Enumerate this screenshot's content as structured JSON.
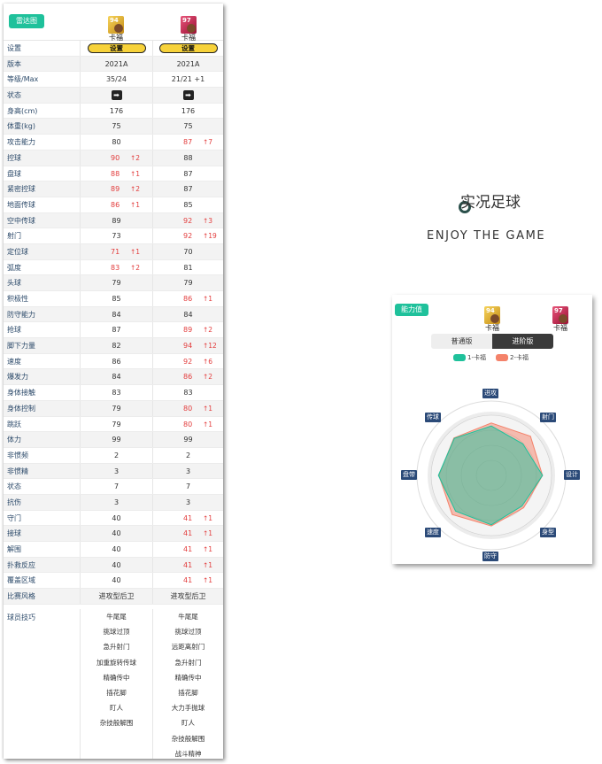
{
  "compare_panel": {
    "radar_button": "雷达图",
    "player1": {
      "rating": "94",
      "name": "卡福"
    },
    "player2": {
      "rating": "97",
      "name": "卡福"
    },
    "rows": [
      {
        "label": "设置",
        "type": "button",
        "v1": "设置",
        "v2": "设置"
      },
      {
        "label": "版本",
        "v1": "2021A",
        "v2": "2021A"
      },
      {
        "label": "等级/Max",
        "v1": "35/24",
        "v2": "21/21 +1"
      },
      {
        "label": "状态",
        "type": "arrow",
        "v1": "➡",
        "v2": "➡"
      },
      {
        "label": "身高(cm)",
        "v1": "176",
        "v2": "176"
      },
      {
        "label": "体重(kg)",
        "v1": "75",
        "v2": "75"
      },
      {
        "label": "攻击能力",
        "v1": "80",
        "v2": "87",
        "d2": "↑7"
      },
      {
        "label": "控球",
        "v1": "90",
        "d1": "↑2",
        "v2": "88"
      },
      {
        "label": "盘球",
        "v1": "88",
        "d1": "↑1",
        "v2": "87"
      },
      {
        "label": "紧密控球",
        "v1": "89",
        "d1": "↑2",
        "v2": "87"
      },
      {
        "label": "地面传球",
        "v1": "86",
        "d1": "↑1",
        "v2": "85"
      },
      {
        "label": "空中传球",
        "v1": "89",
        "v2": "92",
        "d2": "↑3"
      },
      {
        "label": "射门",
        "v1": "73",
        "v2": "92",
        "d2": "↑19"
      },
      {
        "label": "定位球",
        "v1": "71",
        "d1": "↑1",
        "v2": "70"
      },
      {
        "label": "弧度",
        "v1": "83",
        "d1": "↑2",
        "v2": "81"
      },
      {
        "label": "头球",
        "v1": "79",
        "v2": "79"
      },
      {
        "label": "积极性",
        "v1": "85",
        "v2": "86",
        "d2": "↑1"
      },
      {
        "label": "防守能力",
        "v1": "84",
        "v2": "84"
      },
      {
        "label": "抢球",
        "v1": "87",
        "v2": "89",
        "d2": "↑2"
      },
      {
        "label": "脚下力量",
        "v1": "82",
        "v2": "94",
        "d2": "↑12"
      },
      {
        "label": "速度",
        "v1": "86",
        "v2": "92",
        "d2": "↑6"
      },
      {
        "label": "爆发力",
        "v1": "84",
        "v2": "86",
        "d2": "↑2"
      },
      {
        "label": "身体接触",
        "v1": "83",
        "v2": "83"
      },
      {
        "label": "身体控制",
        "v1": "79",
        "v2": "80",
        "d2": "↑1"
      },
      {
        "label": "跳跃",
        "v1": "79",
        "v2": "80",
        "d2": "↑1"
      },
      {
        "label": "体力",
        "v1": "99",
        "v2": "99"
      },
      {
        "label": "非惯频",
        "v1": "2",
        "v2": "2"
      },
      {
        "label": "非惯精",
        "v1": "3",
        "v2": "3"
      },
      {
        "label": "状态",
        "v1": "7",
        "v2": "7"
      },
      {
        "label": "抗伤",
        "v1": "3",
        "v2": "3"
      },
      {
        "label": "守门",
        "v1": "40",
        "v2": "41",
        "d2": "↑1"
      },
      {
        "label": "接球",
        "v1": "40",
        "v2": "41",
        "d2": "↑1"
      },
      {
        "label": "解围",
        "v1": "40",
        "v2": "41",
        "d2": "↑1"
      },
      {
        "label": "扑救反应",
        "v1": "40",
        "v2": "41",
        "d2": "↑1"
      },
      {
        "label": "覆盖区域",
        "v1": "40",
        "v2": "41",
        "d2": "↑1"
      },
      {
        "label": "比赛风格",
        "v1": "进攻型后卫",
        "v2": "进攻型后卫"
      }
    ],
    "skills": {
      "label": "球员技巧",
      "p1": [
        "牛尾尾",
        "挑球过顶",
        "急升射门",
        "加重旋转传球",
        "精确传中",
        "插花脚",
        "盯人",
        "杂技般解围"
      ],
      "p2": [
        "牛尾尾",
        "挑球过顶",
        "远距离射门",
        "急升射门",
        "精确传中",
        "插花脚",
        "大力手抛球",
        "盯人",
        "杂技般解围",
        "战斗精神"
      ]
    }
  },
  "branding": {
    "title": "实况足球",
    "tagline": "ENJOY THE GAME"
  },
  "radar_panel": {
    "ability_button": "能力值",
    "player1": {
      "rating": "94",
      "name": "卡福"
    },
    "player2": {
      "rating": "97",
      "name": "卡福"
    },
    "tabs": [
      "普通版",
      "进阶版"
    ],
    "active_tab": "进阶版",
    "legend": [
      "1-卡福",
      "2-卡福"
    ],
    "colors": {
      "p1": "#1fc19b",
      "p2": "#f4826a",
      "axis_label": "#2b4a78",
      "teal": "#1fc19b"
    },
    "axes": [
      "进攻",
      "射门",
      "设计",
      "身型",
      "防守",
      "速度",
      "盘带",
      "传球"
    ],
    "max": 100,
    "values_p1": [
      82,
      74,
      85,
      72,
      82,
      84,
      88,
      87
    ],
    "values_p2": [
      87,
      92,
      85,
      76,
      84,
      92,
      87,
      88
    ]
  }
}
